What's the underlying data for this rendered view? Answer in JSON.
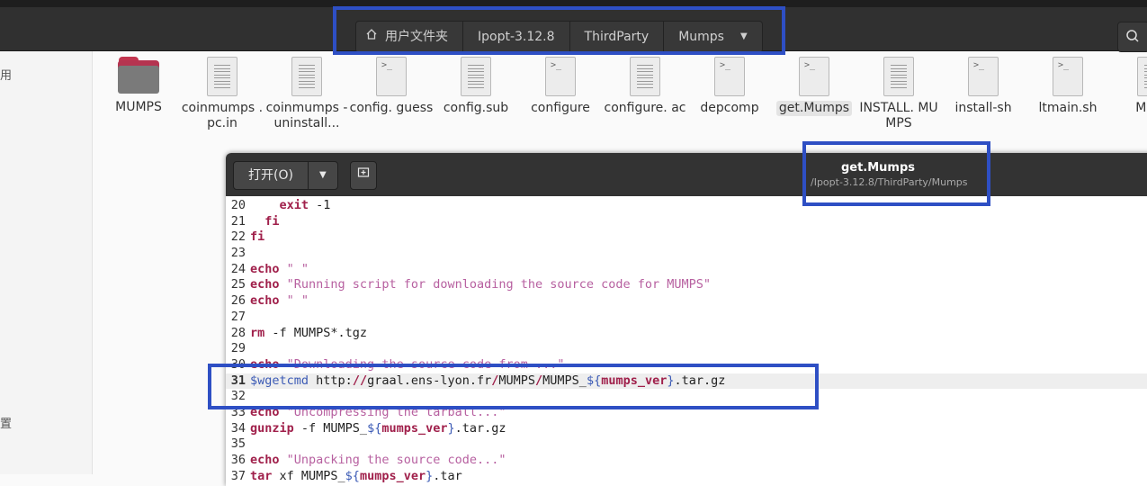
{
  "breadcrumbs": [
    "用户文件夹",
    "Ipopt-3.12.8",
    "ThirdParty",
    "Mumps"
  ],
  "icons": {
    "home": "home-icon",
    "dropdown": "chevron-down-icon",
    "search": "search-icon",
    "new_tab": "new-tab-icon"
  },
  "sidebar": {
    "partial_labels": [
      "用",
      "置"
    ]
  },
  "files": [
    {
      "name": "MUMPS",
      "type": "folder"
    },
    {
      "name": "coinmumps .pc.in",
      "type": "text"
    },
    {
      "name": "coinmumps - uninstall...",
      "type": "text"
    },
    {
      "name": "config. guess",
      "type": "script"
    },
    {
      "name": "config.sub",
      "type": "text"
    },
    {
      "name": "configure",
      "type": "script"
    },
    {
      "name": "configure. ac",
      "type": "text"
    },
    {
      "name": "depcomp",
      "type": "script"
    },
    {
      "name": "get.Mumps",
      "type": "script",
      "selected": true
    },
    {
      "name": "INSTALL. MUMPS",
      "type": "text"
    },
    {
      "name": "install-sh",
      "type": "script"
    },
    {
      "name": "ltmain.sh",
      "type": "script"
    },
    {
      "name": "Mal a",
      "type": "text"
    }
  ],
  "editor": {
    "open_label": "打开(O)",
    "title": "get.Mumps",
    "path": "/Ipopt-3.12.8/ThirdParty/Mumps",
    "lines": [
      {
        "n": "20",
        "parts": [
          {
            "c": "txt",
            "t": "    "
          },
          {
            "c": "kw",
            "t": "exit"
          },
          {
            "c": "txt",
            "t": " -1"
          }
        ]
      },
      {
        "n": "21",
        "parts": [
          {
            "c": "txt",
            "t": "  "
          },
          {
            "c": "kw",
            "t": "fi"
          }
        ]
      },
      {
        "n": "22",
        "parts": [
          {
            "c": "kw",
            "t": "fi"
          }
        ]
      },
      {
        "n": "23",
        "parts": []
      },
      {
        "n": "24",
        "parts": [
          {
            "c": "kw",
            "t": "echo"
          },
          {
            "c": "txt",
            "t": " "
          },
          {
            "c": "str",
            "t": "\" \""
          }
        ]
      },
      {
        "n": "25",
        "parts": [
          {
            "c": "kw",
            "t": "echo"
          },
          {
            "c": "txt",
            "t": " "
          },
          {
            "c": "str",
            "t": "\"Running script for downloading the source code for MUMPS\""
          }
        ]
      },
      {
        "n": "26",
        "parts": [
          {
            "c": "kw",
            "t": "echo"
          },
          {
            "c": "txt",
            "t": " "
          },
          {
            "c": "str",
            "t": "\" \""
          }
        ]
      },
      {
        "n": "27",
        "parts": []
      },
      {
        "n": "28",
        "parts": [
          {
            "c": "kw",
            "t": "rm"
          },
          {
            "c": "txt",
            "t": " -f MUMPS*.tgz"
          }
        ]
      },
      {
        "n": "29",
        "parts": []
      },
      {
        "n": "30",
        "parts": [
          {
            "c": "kw",
            "t": "echo"
          },
          {
            "c": "txt",
            "t": " "
          },
          {
            "c": "str",
            "t": "\"Downloading the source code from ...\""
          }
        ]
      },
      {
        "n": "31",
        "current": true,
        "parts": [
          {
            "c": "var",
            "t": "$wgetcmd"
          },
          {
            "c": "txt",
            "t": " http:"
          },
          {
            "c": "kw",
            "t": "//"
          },
          {
            "c": "txt",
            "t": "graal.ens-lyon.fr"
          },
          {
            "c": "kw",
            "t": "/"
          },
          {
            "c": "txt",
            "t": "MUMPS"
          },
          {
            "c": "kw",
            "t": "/"
          },
          {
            "c": "txt",
            "t": "MUMPS_"
          },
          {
            "c": "var",
            "t": "${"
          },
          {
            "c": "kw",
            "t": "mumps_ver"
          },
          {
            "c": "var",
            "t": "}"
          },
          {
            "c": "txt",
            "t": ".tar.gz"
          }
        ]
      },
      {
        "n": "32",
        "parts": []
      },
      {
        "n": "33",
        "parts": [
          {
            "c": "kw",
            "t": "echo"
          },
          {
            "c": "txt",
            "t": " "
          },
          {
            "c": "str",
            "t": "\"Uncompressing the tarball...\""
          }
        ]
      },
      {
        "n": "34",
        "parts": [
          {
            "c": "kw",
            "t": "gunzip"
          },
          {
            "c": "txt",
            "t": " -f MUMPS_"
          },
          {
            "c": "var",
            "t": "${"
          },
          {
            "c": "kw",
            "t": "mumps_ver"
          },
          {
            "c": "var",
            "t": "}"
          },
          {
            "c": "txt",
            "t": ".tar.gz"
          }
        ]
      },
      {
        "n": "35",
        "parts": []
      },
      {
        "n": "36",
        "parts": [
          {
            "c": "kw",
            "t": "echo"
          },
          {
            "c": "txt",
            "t": " "
          },
          {
            "c": "str",
            "t": "\"Unpacking the source code...\""
          }
        ]
      },
      {
        "n": "37",
        "parts": [
          {
            "c": "kw",
            "t": "tar"
          },
          {
            "c": "txt",
            "t": " xf MUMPS_"
          },
          {
            "c": "var",
            "t": "${"
          },
          {
            "c": "kw",
            "t": "mumps_ver"
          },
          {
            "c": "var",
            "t": "}"
          },
          {
            "c": "txt",
            "t": ".tar"
          }
        ]
      }
    ]
  },
  "colors": {
    "highlight": "#2e4fc4",
    "keyword": "#a0204b",
    "string": "#b760a0",
    "variable": "#3b5ab5"
  }
}
